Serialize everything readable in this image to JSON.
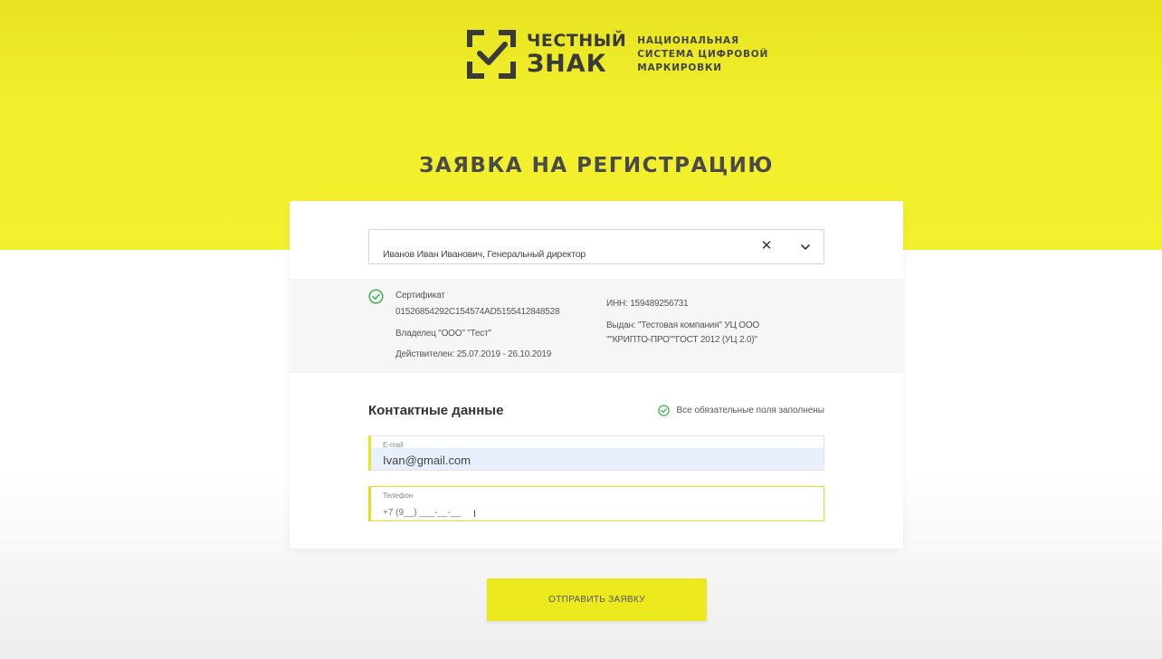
{
  "brand": {
    "name_line1": "ЧЕСТНЫЙ",
    "name_line2": "ЗНАК",
    "tagline_line1": "НАЦИОНАЛЬНАЯ",
    "tagline_line2": "СИСТЕМА ЦИФРОВОЙ",
    "tagline_line3": "МАРКИРОВКИ",
    "color": "#3a3a3a"
  },
  "page": {
    "title": "ЗАЯВКА НА РЕГИСТРАЦИЮ",
    "accent_color": "#f3f12e"
  },
  "signer_select": {
    "value": "Иванов Иван Иванович, Генеральный директор",
    "clear_icon": "close-icon",
    "chevron_icon": "chevron-down-icon"
  },
  "certificate": {
    "status_icon": "check-circle-icon",
    "label": "Сертификат",
    "number": "01526854292C154574AD5155412848528",
    "owner": "Владелец \"ООО\" \"Тест\"",
    "validity": "Действителен: 25.07.2019 - 26.10.2019",
    "inn": "ИНН: 159489256731",
    "issuer_line1": "Выдан: \"Тестовая компания\" УЦ ООО",
    "issuer_line2": "\"\"КРИПТО-ПРО\"\"ГОСТ 2012 (УЦ 2.0)\""
  },
  "contacts": {
    "title": "Контактные данные",
    "status_text": "Все обязательные поля заполнены",
    "email": {
      "label": "E-mail",
      "value": "Ivan@gmail.com"
    },
    "phone": {
      "label": "Телефон",
      "placeholder": "+7 (9__) ___-__-__"
    }
  },
  "submit": {
    "label": "ОТПРАВИТЬ ЗАЯВКУ"
  }
}
